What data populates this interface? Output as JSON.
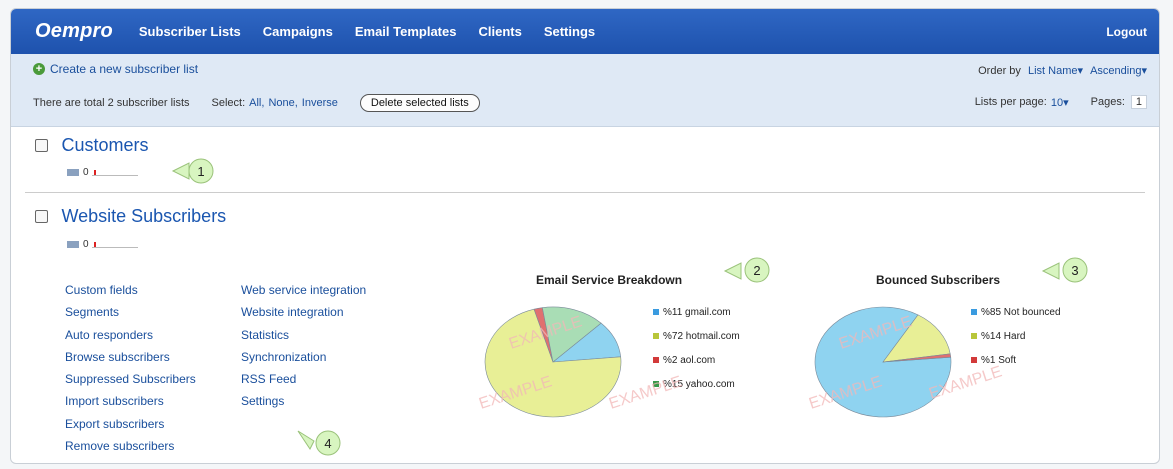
{
  "nav": {
    "logo": "Oempro",
    "links": [
      "Subscriber Lists",
      "Campaigns",
      "Email Templates",
      "Clients",
      "Settings"
    ],
    "logout": "Logout"
  },
  "toolbar": {
    "create_label": "Create a new subscriber list",
    "order_by_label": "Order by",
    "order_field": "List Name",
    "order_dir": "Ascending",
    "total_text": "There are total 2 subscriber lists",
    "select_label": "Select:",
    "select_all": "All,",
    "select_none": "None,",
    "select_inverse": "Inverse",
    "delete_label": "Delete selected lists",
    "per_page_label": "Lists per page:",
    "per_page_value": "10",
    "pages_label": "Pages:",
    "pages_value": "1"
  },
  "lists": [
    {
      "name": "Customers",
      "count": "0"
    },
    {
      "name": "Website Subscribers",
      "count": "0"
    }
  ],
  "links_col1": [
    "Custom fields",
    "Segments",
    "Auto responders",
    "Browse subscribers",
    "Suppressed Subscribers",
    "Import subscribers",
    "Export subscribers",
    "Remove subscribers"
  ],
  "links_col2": [
    "Web service integration",
    "Website integration",
    "Statistics",
    "Synchronization",
    "RSS Feed",
    "Settings"
  ],
  "chart_data": [
    {
      "type": "pie",
      "title": "Email Service Breakdown",
      "categories": [
        "gmail.com",
        "hotmail.com",
        "aol.com",
        "yahoo.com"
      ],
      "values": [
        11,
        72,
        2,
        15
      ],
      "labels": [
        "%11 gmail.com",
        "%72 hotmail.com",
        "%2 aol.com",
        "%15 yahoo.com"
      ],
      "colors": [
        "#8fd3f0",
        "#e8ef96",
        "#e07070",
        "#a9ddb5"
      ],
      "legend_colors": [
        "#3a9be0",
        "#b8c63a",
        "#d23a3a",
        "#3a9a4a"
      ]
    },
    {
      "type": "pie",
      "title": "Bounced Subscribers",
      "categories": [
        "Not bounced",
        "Hard",
        "Soft"
      ],
      "values": [
        85,
        14,
        1
      ],
      "labels": [
        "%85 Not bounced",
        "%14 Hard",
        "%1 Soft"
      ],
      "colors": [
        "#8fd3f0",
        "#e8ef96",
        "#e07070"
      ],
      "legend_colors": [
        "#3a9be0",
        "#b8c63a",
        "#d23a3a"
      ]
    }
  ],
  "callouts": [
    "1",
    "2",
    "3",
    "4"
  ],
  "watermark": "EXAMPLE"
}
